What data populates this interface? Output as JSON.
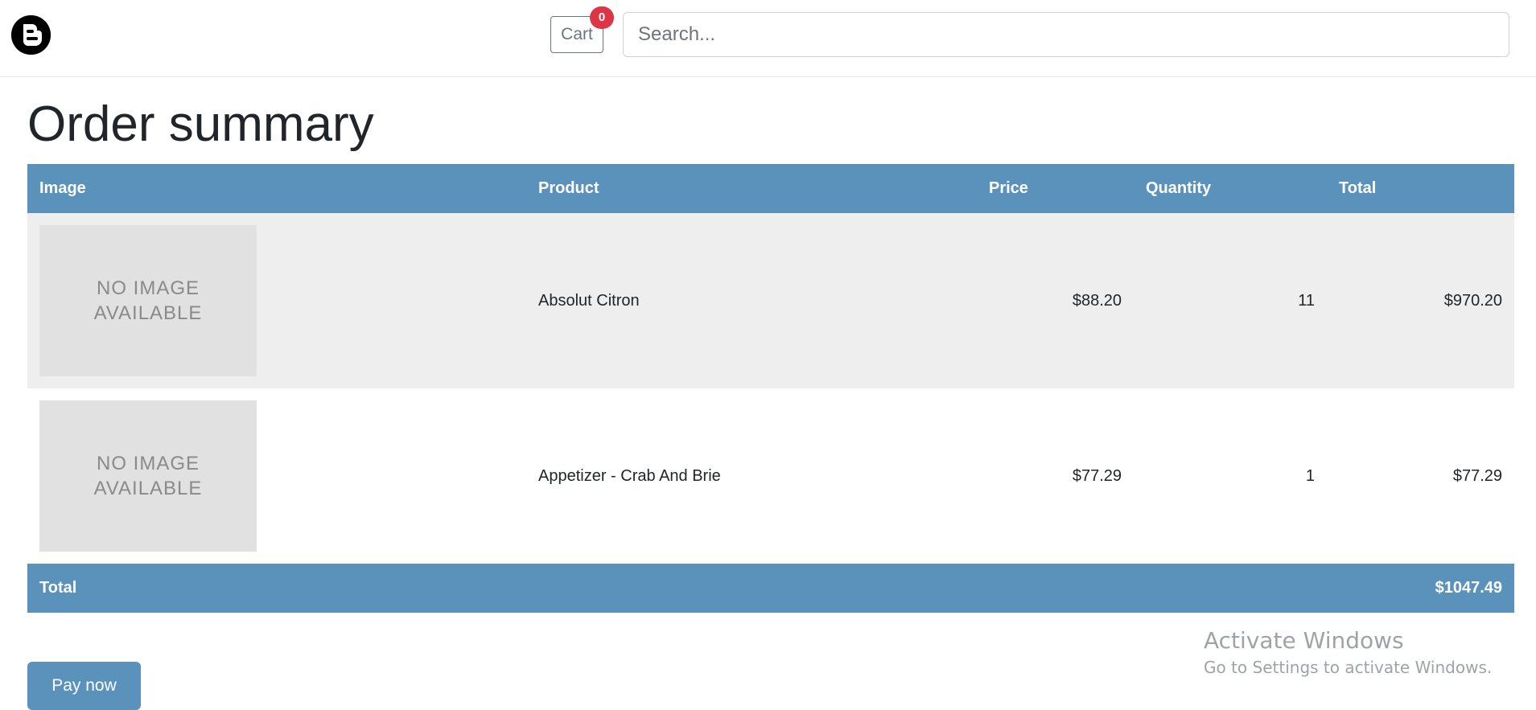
{
  "header": {
    "logo_icon": "blogger-logo-icon",
    "cart_label": "Cart",
    "cart_count": "0",
    "search_placeholder": "Search...",
    "search_value": ""
  },
  "main": {
    "title": "Order summary",
    "table": {
      "columns": [
        "Image",
        "Product",
        "Price",
        "Quantity",
        "Total"
      ],
      "rows": [
        {
          "image_line1": "NO IMAGE",
          "image_line2": "AVAILABLE",
          "product": "Absolut Citron",
          "price": "$88.20",
          "quantity": "11",
          "total": "$970.20"
        },
        {
          "image_line1": "NO IMAGE",
          "image_line2": "AVAILABLE",
          "product": "Appetizer - Crab And Brie",
          "price": "$77.29",
          "quantity": "1",
          "total": "$77.29"
        }
      ],
      "footer": {
        "label": "Total",
        "value": "$1047.49"
      }
    },
    "pay_button_label": "Pay now"
  },
  "watermark": {
    "title": "Activate Windows",
    "subtitle": "Go to Settings to activate Windows."
  },
  "colors": {
    "accent": "#5a92bb",
    "badge": "#dc3545",
    "row_striped": "#eeeeee",
    "placeholder_bg": "#e1e1e1"
  }
}
